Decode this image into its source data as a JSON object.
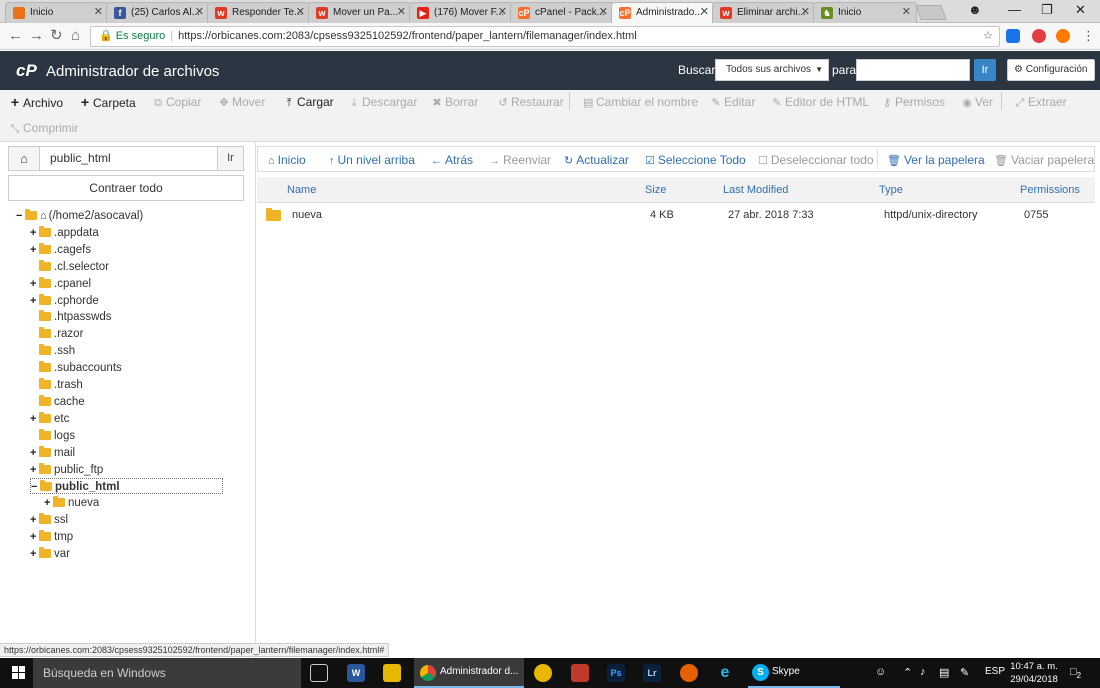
{
  "browser": {
    "tabs": [
      {
        "title": "Inicio",
        "icon": "orange-square",
        "color": "#e8711a"
      },
      {
        "title": "(25) Carlos Al...",
        "icon": "facebook",
        "color": "#3b5998"
      },
      {
        "title": "Responder Te...",
        "icon": "w-logo",
        "color": "#e03b24"
      },
      {
        "title": "Mover un Pa...",
        "icon": "w-logo",
        "color": "#e03b24"
      },
      {
        "title": "(176) Mover F...",
        "icon": "youtube",
        "color": "#e62117"
      },
      {
        "title": "cPanel - Pack...",
        "icon": "cpanel",
        "color": "#ff6c2c"
      },
      {
        "title": "Administrado...",
        "icon": "cpanel",
        "color": "#ff6c2c"
      },
      {
        "title": "Eliminar archi...",
        "icon": "w-logo",
        "color": "#e03b24"
      },
      {
        "title": "Inicio",
        "icon": "dog",
        "color": "#6b8e23"
      }
    ],
    "secure_label": "Es seguro",
    "url": "https://orbicanes.com:2083/cpsess9325102592/frontend/paper_lantern/filemanager/index.html",
    "status_url": "https://orbicanes.com:2083/cpsess9325102592/frontend/paper_lantern/filemanager/index.html#"
  },
  "header": {
    "logo": "cP",
    "title": "Administrador de archivos",
    "search_label": "Buscar",
    "search_scope": "Todos sus archivos",
    "para_label": "para",
    "search_value": "",
    "search_go": "Ir",
    "settings": "Configuración"
  },
  "toolbar": {
    "row1": [
      {
        "label": "Archivo",
        "icon": "+",
        "enabled": true
      },
      {
        "label": "Carpeta",
        "icon": "+",
        "enabled": true
      },
      {
        "label": "Copiar",
        "icon": "⧉",
        "enabled": false
      },
      {
        "label": "Mover",
        "icon": "✥",
        "enabled": false
      },
      {
        "label": "Cargar",
        "icon": "⤒",
        "enabled": true
      },
      {
        "label": "Descargar",
        "icon": "⤓",
        "enabled": false
      },
      {
        "label": "Borrar",
        "icon": "✖",
        "enabled": false
      },
      {
        "label": "Restaurar",
        "icon": "↺",
        "enabled": false
      },
      {
        "label": "Cambiar el nombre",
        "icon": "▤",
        "enabled": false
      },
      {
        "label": "Editar",
        "icon": "✎",
        "enabled": false
      },
      {
        "label": "Editor de HTML",
        "icon": "✎",
        "enabled": false
      },
      {
        "label": "Permisos",
        "icon": "⚷",
        "enabled": false
      },
      {
        "label": "Ver",
        "icon": "◉",
        "enabled": false
      },
      {
        "label": "Extraer",
        "icon": "⤢",
        "enabled": false
      }
    ],
    "row2": [
      {
        "label": "Comprimir",
        "icon": "⤡",
        "enabled": false
      }
    ]
  },
  "sidebar": {
    "path": "public_html",
    "go": "Ir",
    "collapse": "Contraer todo",
    "tree": [
      {
        "label": "(/home2/asocaval)",
        "toggle": "−",
        "depth": 0,
        "home": true
      },
      {
        "label": ".appdata",
        "toggle": "+",
        "depth": 1
      },
      {
        "label": ".cagefs",
        "toggle": "+",
        "depth": 1
      },
      {
        "label": ".cl.selector",
        "toggle": "",
        "depth": 1
      },
      {
        "label": ".cpanel",
        "toggle": "+",
        "depth": 1
      },
      {
        "label": ".cphorde",
        "toggle": "+",
        "depth": 1
      },
      {
        "label": ".htpasswds",
        "toggle": "",
        "depth": 1
      },
      {
        "label": ".razor",
        "toggle": "",
        "depth": 1
      },
      {
        "label": ".ssh",
        "toggle": "",
        "depth": 1
      },
      {
        "label": ".subaccounts",
        "toggle": "",
        "depth": 1
      },
      {
        "label": ".trash",
        "toggle": "",
        "depth": 1
      },
      {
        "label": "cache",
        "toggle": "",
        "depth": 1
      },
      {
        "label": "etc",
        "toggle": "+",
        "depth": 1
      },
      {
        "label": "logs",
        "toggle": "",
        "depth": 1
      },
      {
        "label": "mail",
        "toggle": "+",
        "depth": 1
      },
      {
        "label": "public_ftp",
        "toggle": "+",
        "depth": 1
      },
      {
        "label": "public_html",
        "toggle": "−",
        "depth": 1,
        "selected": true
      },
      {
        "label": "nueva",
        "toggle": "+",
        "depth": 2
      },
      {
        "label": "ssl",
        "toggle": "+",
        "depth": 1
      },
      {
        "label": "tmp",
        "toggle": "+",
        "depth": 1
      },
      {
        "label": "var",
        "toggle": "+",
        "depth": 1
      }
    ]
  },
  "actions": [
    {
      "label": "Inicio",
      "icon": "⌂",
      "enabled": true
    },
    {
      "label": "Un nivel arriba",
      "icon": "↑",
      "enabled": true
    },
    {
      "label": "Atrás",
      "icon": "←",
      "enabled": true
    },
    {
      "label": "Reenviar",
      "icon": "→",
      "enabled": false
    },
    {
      "label": "Actualizar",
      "icon": "↻",
      "enabled": true
    },
    {
      "label": "Seleccione Todo",
      "icon": "☑",
      "enabled": true
    },
    {
      "label": "Deseleccionar todo",
      "icon": "☐",
      "enabled": false
    },
    {
      "label": "Ver la papelera",
      "icon": "🗑",
      "enabled": true
    },
    {
      "label": "Vaciar papelera",
      "icon": "🗑",
      "enabled": false
    }
  ],
  "table": {
    "headers": [
      "Name",
      "Size",
      "Last Modified",
      "Type",
      "Permissions"
    ],
    "rows": [
      {
        "name": "nueva",
        "size": "4 KB",
        "modified": "27 abr. 2018 7:33",
        "type": "httpd/unix-directory",
        "perms": "0755"
      }
    ]
  },
  "taskbar": {
    "search": "Búsqueda en Windows",
    "chrome_label": "Administrador d...",
    "skype_label": "Skype",
    "lang": "ESP",
    "time": "10:47 a. m.",
    "date": "29/04/2018",
    "notif_count": "2"
  }
}
